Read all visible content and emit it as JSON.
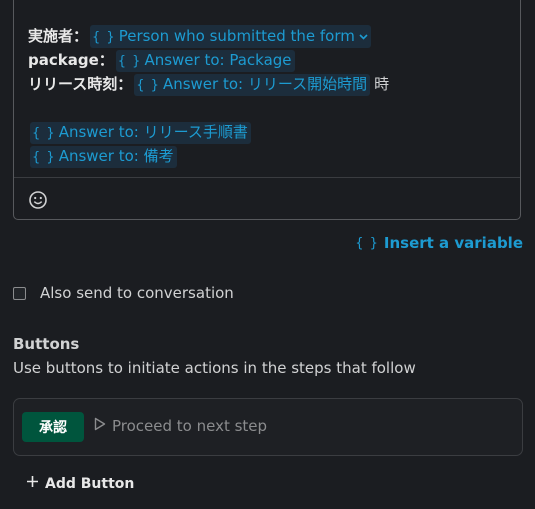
{
  "editor": {
    "lines": [
      {
        "label": "実施者：",
        "var": "Person who submitted the form",
        "has_dropdown": true
      },
      {
        "label": "package：",
        "var": "Answer to: Package"
      },
      {
        "label": "リリース時刻：",
        "var": "Answer to: リリース開始時間",
        "suffix": "時"
      },
      {
        "var": "Answer to: リリース手順書"
      },
      {
        "var": "Answer to: 備考"
      }
    ],
    "var_brace": "{ }",
    "emoji_icon": "smiley-icon"
  },
  "insert_variable": {
    "brace": "{ }",
    "label": "Insert a variable"
  },
  "also_send": {
    "label": "Also send to conversation",
    "checked": false
  },
  "buttons_section": {
    "title": "Buttons",
    "description": "Use buttons to initiate actions in the steps that follow",
    "button": {
      "label": "承認",
      "action": "Proceed to next step",
      "color": "#00553d"
    },
    "add_label": "Add Button"
  },
  "colors": {
    "accent": "#1d9bd1",
    "background": "#1b1d21"
  }
}
